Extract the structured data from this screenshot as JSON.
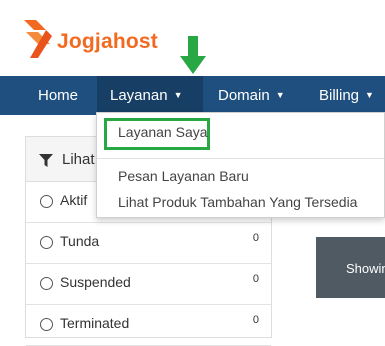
{
  "brand": {
    "name": "Jogjahost",
    "color": "#f26a21"
  },
  "nav": {
    "items": [
      {
        "label": "Home",
        "has_caret": false
      },
      {
        "label": "Layanan",
        "has_caret": true,
        "active": true
      },
      {
        "label": "Domain",
        "has_caret": true
      },
      {
        "label": "Billing",
        "has_caret": true
      }
    ],
    "background": "#1f4f7e"
  },
  "dropdown": {
    "items": [
      {
        "label": "Layanan Saya",
        "highlighted": true
      },
      {
        "label": "Pesan Layanan Baru"
      },
      {
        "label": "Lihat Produk Tambahan Yang Tersedia"
      }
    ],
    "highlight_color": "#28a745"
  },
  "sidebar": {
    "title": "Lihat",
    "icon": "filter-icon",
    "statuses": [
      {
        "label": "Aktif",
        "count": ""
      },
      {
        "label": "Tunda",
        "count": "0"
      },
      {
        "label": "Suspended",
        "count": "0"
      },
      {
        "label": "Terminated",
        "count": "0"
      }
    ]
  },
  "main": {
    "showing_text": "Showing"
  },
  "annotation": {
    "arrow_color": "#28a745"
  }
}
